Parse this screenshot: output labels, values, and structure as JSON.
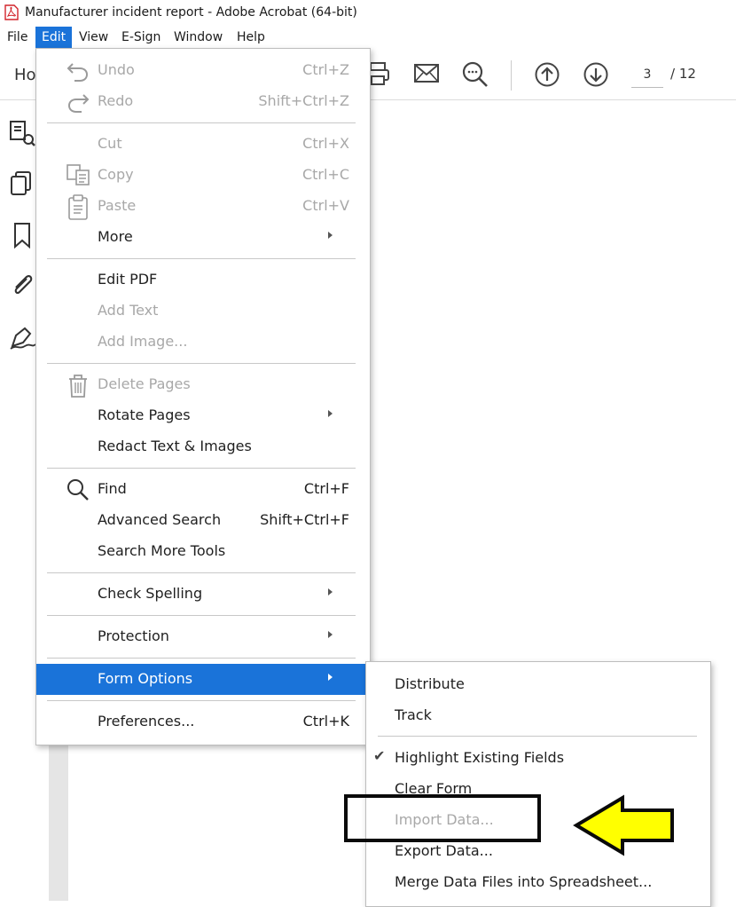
{
  "window": {
    "title": "Manufacturer incident report - Adobe Acrobat (64-bit)",
    "app_icon": "acrobat-pdf-icon"
  },
  "menubar": {
    "items": [
      {
        "label": "File"
      },
      {
        "label": "Edit",
        "active": true
      },
      {
        "label": "View"
      },
      {
        "label": "E-Sign"
      },
      {
        "label": "Window"
      },
      {
        "label": "Help"
      }
    ]
  },
  "toolbar": {
    "home_tab": "Ho",
    "icons": [
      "print-icon",
      "email-icon",
      "zoom-search-icon",
      "previous-page-icon",
      "next-page-icon"
    ],
    "page_current": "3",
    "page_total": "/ 12"
  },
  "left_panel": {
    "icons": [
      "organize-pages-icon",
      "copy-pages-icon",
      "bookmark-icon",
      "attachment-icon",
      "sign-icon"
    ]
  },
  "edit_menu": {
    "items": [
      {
        "label": "Undo",
        "shortcut": "Ctrl+Z",
        "enabled": false,
        "icon": "undo-icon"
      },
      {
        "label": "Redo",
        "shortcut": "Shift+Ctrl+Z",
        "enabled": false,
        "icon": "redo-icon"
      },
      {
        "label": "Cut",
        "shortcut": "Ctrl+X",
        "enabled": false
      },
      {
        "label": "Copy",
        "shortcut": "Ctrl+C",
        "enabled": false,
        "icon": "copy-icon"
      },
      {
        "label": "Paste",
        "shortcut": "Ctrl+V",
        "enabled": false,
        "icon": "paste-icon"
      },
      {
        "label": "More",
        "submenu": true,
        "enabled": true
      },
      {
        "label": "Edit PDF",
        "enabled": true
      },
      {
        "label": "Add Text",
        "enabled": false
      },
      {
        "label": "Add Image...",
        "enabled": false
      },
      {
        "label": "Delete Pages",
        "enabled": false,
        "icon": "trash-icon"
      },
      {
        "label": "Rotate Pages",
        "submenu": true,
        "enabled": true
      },
      {
        "label": "Redact Text & Images",
        "enabled": true
      },
      {
        "label": "Find",
        "shortcut": "Ctrl+F",
        "enabled": true,
        "icon": "search-icon"
      },
      {
        "label": "Advanced Search",
        "shortcut": "Shift+Ctrl+F",
        "enabled": true
      },
      {
        "label": "Search More Tools",
        "enabled": true
      },
      {
        "label": "Check Spelling",
        "submenu": true,
        "enabled": true
      },
      {
        "label": "Protection",
        "submenu": true,
        "enabled": true
      },
      {
        "label": "Form Options",
        "submenu": true,
        "enabled": true,
        "highlighted": true
      },
      {
        "label": "Preferences...",
        "shortcut": "Ctrl+K",
        "enabled": true
      }
    ]
  },
  "form_options_submenu": {
    "items": [
      {
        "label": "Distribute",
        "enabled": true
      },
      {
        "label": "Track",
        "enabled": true
      },
      {
        "label": "Highlight Existing Fields",
        "enabled": true,
        "checked": true
      },
      {
        "label": "Clear Form",
        "enabled": true
      },
      {
        "label": "Import Data...",
        "enabled": false
      },
      {
        "label": "Export Data...",
        "enabled": true
      },
      {
        "label": "Merge Data Files into Spreadsheet...",
        "enabled": true
      }
    ]
  },
  "annotations": {
    "box_color": "#0a0a0a",
    "arrow_color": "#ffff00",
    "arrow_direction": "left"
  },
  "colors": {
    "accent": "#1a73d9",
    "disabled_text": "#a8a8a8"
  }
}
